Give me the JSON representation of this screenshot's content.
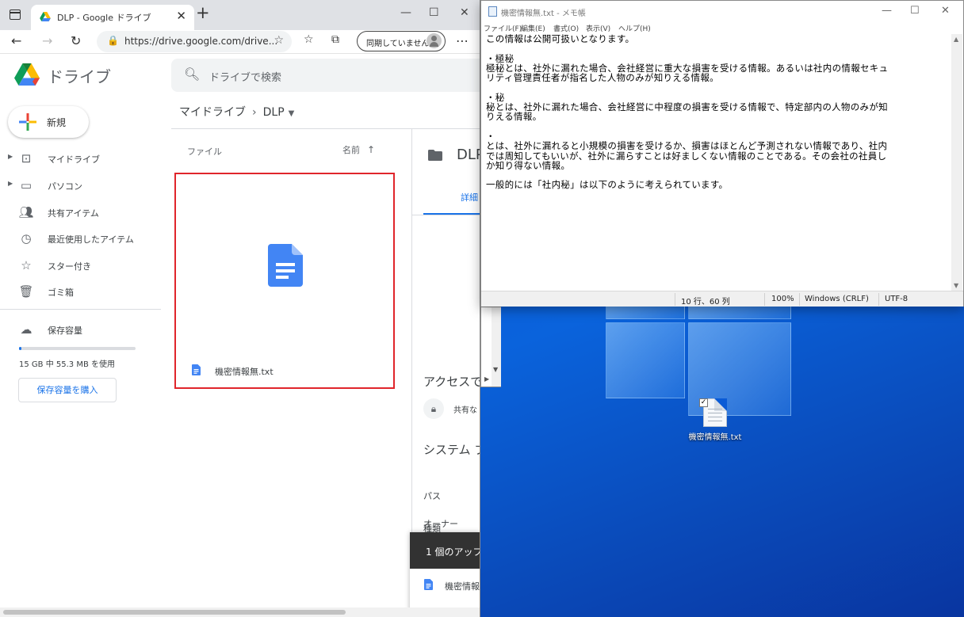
{
  "browser": {
    "tab_title": "DLP - Google ドライブ",
    "url": "https://drive.google.com/drive...",
    "sync_label": "同期していません",
    "window_controls": {
      "minimize": "—",
      "maximize": "☐",
      "close": "✕"
    }
  },
  "drive": {
    "brand": "ドライブ",
    "search_placeholder": "ドライブで検索",
    "new_label": "新規",
    "nav": [
      {
        "label": "マイドライブ",
        "icon": "my-drive-icon"
      },
      {
        "label": "パソコン",
        "icon": "computer-icon"
      },
      {
        "label": "共有アイテム",
        "icon": "shared-icon"
      },
      {
        "label": "最近使用したアイテム",
        "icon": "clock-icon"
      },
      {
        "label": "スター付き",
        "icon": "star-icon"
      },
      {
        "label": "ゴミ箱",
        "icon": "trash-icon"
      }
    ],
    "storage": {
      "label": "保存容量",
      "usage_text": "15 GB 中 55.3 MB を使用",
      "used_fraction": 0.0036,
      "buy_label": "保存容量を購入"
    },
    "breadcrumb": {
      "root": "マイドライブ",
      "current": "DLP"
    },
    "list_header": {
      "files": "ファイル",
      "sort": "名前"
    },
    "file": {
      "name": "機密情報無.txt",
      "icon": "google-docs-icon"
    },
    "details": {
      "name": "DLP",
      "tab": "詳細",
      "access_heading": "アクセスで",
      "shared_text": "共有な",
      "system_heading": "システム プ",
      "type_label": "種類",
      "path_label": "パス",
      "owner_label": "オーナー"
    },
    "upload": {
      "header": "1 個のアップ",
      "file_name": "機密情報"
    }
  },
  "notepad": {
    "title": "機密情報無.txt - メモ帳",
    "menu": [
      "ファイル(F)",
      "編集(E)",
      "書式(O)",
      "表示(V)",
      "ヘルプ(H)"
    ],
    "lines": [
      "この情報は公開可扱いとなります。",
      "",
      "・極秘",
      "極秘とは、社外に漏れた場合、会社経営に重大な損害を受ける情報。あるいは社内の情報セキュ",
      "リティ管理責任者が指名した人物のみが知りえる情報。",
      "",
      "・秘",
      "秘とは、社外に漏れた場合、会社経営に中程度の損害を受ける情報で、特定部内の人物のみが知",
      "りえる情報。",
      "",
      "・",
      "とは、社外に漏れると小規模の損害を受けるか、損害はほとんど予測されない情報であり、社内",
      "では周知してもいいが、社外に漏らすことは好ましくない情報のことである。その会社の社員し",
      "か知り得ない情報。",
      "",
      "一般的には「社内秘」は以下のように考えられています。"
    ],
    "status": {
      "position": "10 行、60 列",
      "zoom": "100%",
      "line_ending": "Windows (CRLF)",
      "encoding": "UTF-8"
    }
  },
  "desktop": {
    "icon_label": "機密情報無.txt"
  }
}
